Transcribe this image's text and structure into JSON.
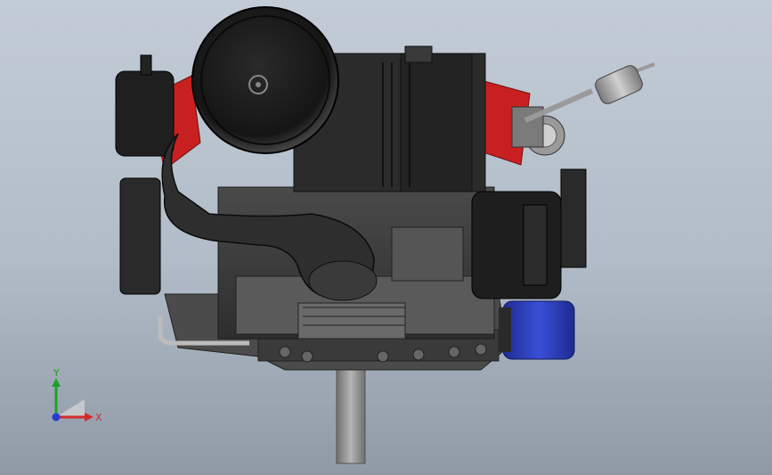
{
  "viewport": {
    "background_top": "#c3ccd6",
    "background_bottom": "#8f9aa6"
  },
  "model": {
    "body_color": "#3a3a3a",
    "dark_color": "#1c1c1c",
    "accent_red": "#c82020",
    "accent_blue": "#2a3bb8",
    "metal_color": "#8a8a8a"
  },
  "triad": {
    "y_label": "Y",
    "x_label": "X",
    "y_color": "#1fa02a",
    "x_color": "#d42a2a",
    "z_color": "#2a3bd4"
  }
}
